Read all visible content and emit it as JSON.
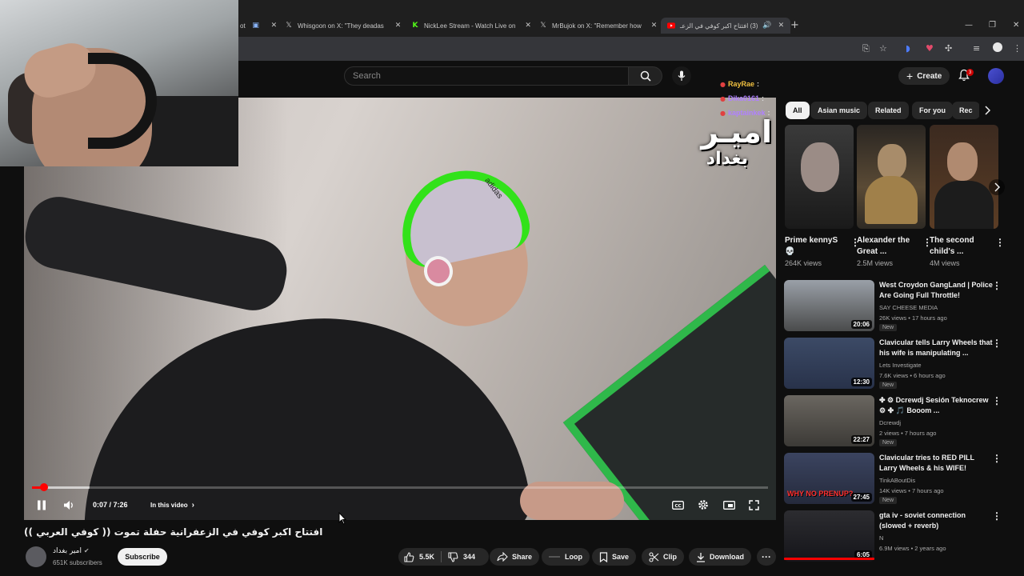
{
  "tabs": [
    {
      "icon": "x-icon",
      "title": "Whisgoon on X: \"They deadas"
    },
    {
      "icon": "kick-icon",
      "title": "NickLee Stream - Watch Live on"
    },
    {
      "icon": "x-icon",
      "title": "MrBujok on X: \"Remember how"
    },
    {
      "icon": "youtube-icon",
      "title": "(3) افتتاح اكبر كوفي في الزعـ"
    }
  ],
  "youtube": {
    "search_placeholder": "Search",
    "create_label": "Create",
    "notification_count": "3"
  },
  "chat": [
    {
      "user": "RayRae",
      "color": "#f0c040",
      "sep": ":"
    },
    {
      "user": "Dika0161",
      "color": "#b080ff",
      "sep": ":"
    },
    {
      "user": "kaptainkek",
      "color": "#b080ff",
      "sep": ":"
    }
  ],
  "player": {
    "overlay_title_line1": "اميـر",
    "overlay_title_line2": "بغداد",
    "beanie_text": "adidas",
    "time": "0:07 / 7:26",
    "chapter": "In this video",
    "progress_fraction": 0.016
  },
  "video": {
    "title": "افتتاح اكبر كوفي في الزعفرانية حفلة تموت (( كوفي العربي ))",
    "channel_name": "امير بغداد",
    "subscribers": "651K subscribers",
    "subscribe_label": "Subscribe",
    "likes": "5.5K",
    "dislikes": "344",
    "actions": {
      "share": "Share",
      "loop": "Loop",
      "save": "Save",
      "clip": "Clip",
      "download": "Download"
    }
  },
  "chips": [
    "All",
    "Asian music",
    "Related",
    "For you",
    "Rec"
  ],
  "shorts": [
    {
      "title": "Prime kennyS 💀",
      "views": "264K views"
    },
    {
      "title": "Alexander the Great ...",
      "views": "2.5M views"
    },
    {
      "title": "The second child's ...",
      "views": "4M views"
    }
  ],
  "recommendations": [
    {
      "title": "West Croydon GangLand | Police Are Going Full Throttle!",
      "channel": "SAY CHEESE MEDIA",
      "meta": "26K views • 17 hours ago",
      "badge": "New",
      "duration": "20:06"
    },
    {
      "title": "Clavicular tells Larry Wheels that his wife is manipulating ...",
      "channel": "Lets Investigate",
      "meta": "7.6K views • 6 hours ago",
      "badge": "New",
      "duration": "12:30"
    },
    {
      "title": "✤ ⚙ Dcrewdj Sesión Teknocrew ⚙ ✤ 🎵 Booom ...",
      "channel": "Dcrewdj",
      "meta": "2 views • 7 hours ago",
      "badge": "New",
      "duration": "22:27"
    },
    {
      "title": "Clavicular tries to RED PILL Larry Wheels & his WIFE!",
      "channel": "TinkABoutDis",
      "meta": "14K views • 7 hours ago",
      "badge": "New",
      "duration": "27:45",
      "thumb_text": "WHY NO PRENUP?"
    },
    {
      "title": "gta iv - soviet connection (slowed + reverb)",
      "channel": "N",
      "meta": "6.9M views • 2 years ago",
      "badge": "",
      "duration": "6:05"
    }
  ]
}
